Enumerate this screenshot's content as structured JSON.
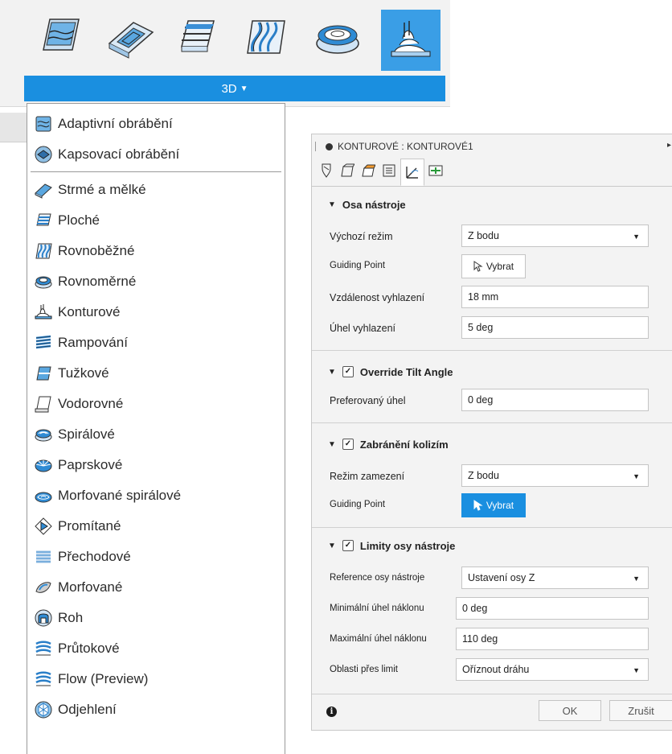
{
  "toolbar": {
    "group_label": "3D",
    "icons": [
      "adaptive-icon",
      "pocket-icon",
      "flat-icon",
      "parallel-icon",
      "scallop-icon",
      "contour-icon"
    ]
  },
  "menu": {
    "items": [
      "Adaptivní obrábění",
      "Kapsovací obrábění",
      "Strmé a mělké",
      "Ploché",
      "Rovnoběžné",
      "Rovnoměrné",
      "Konturové",
      "Rampování",
      "Tužkové",
      "Vodorovné",
      "Spirálové",
      "Paprskové",
      "Morfované spirálové",
      "Promítané",
      "Přechodové",
      "Morfované",
      "Roh",
      "Průtokové",
      "Flow (Preview)",
      "Odjehlení"
    ]
  },
  "dialog": {
    "title": "KONTUROVÉ : KONTUROVÉ1",
    "sections": {
      "tool_axis": {
        "title": "Osa nástroje",
        "default_mode_label": "Výchozí režim",
        "default_mode_value": "Z bodu",
        "guiding_point_label": "Guiding Point",
        "select_label": "Vybrat",
        "smoothing_distance_label": "Vzdálenost vyhlazení",
        "smoothing_distance_value": "18 mm",
        "smoothing_angle_label": "Úhel vyhlazení",
        "smoothing_angle_value": "5 deg"
      },
      "tilt": {
        "title": "Override Tilt Angle",
        "checked": true,
        "preferred_angle_label": "Preferovaný úhel",
        "preferred_angle_value": "0 deg"
      },
      "collision": {
        "title": "Zabránění kolizím",
        "checked": true,
        "mode_label": "Režim zamezení",
        "mode_value": "Z bodu",
        "guiding_point_label": "Guiding Point",
        "select_label": "Vybrat"
      },
      "limits": {
        "title": "Limity osy nástroje",
        "checked": true,
        "reference_label": "Reference osy nástroje",
        "reference_value": "Ustavení osy Z",
        "min_label": "Minimální úhel náklonu",
        "min_value": "0 deg",
        "max_label": "Maximální úhel náklonu",
        "max_value": "110 deg",
        "over_limit_label": "Oblasti přes limit",
        "over_limit_value": "Oříznout dráhu"
      }
    },
    "footer": {
      "info": "i",
      "ok_label": "OK",
      "cancel_label": "Zrušit"
    }
  },
  "colors": {
    "accent": "#1a8fe0",
    "active_tool": "#3a9ee6"
  }
}
